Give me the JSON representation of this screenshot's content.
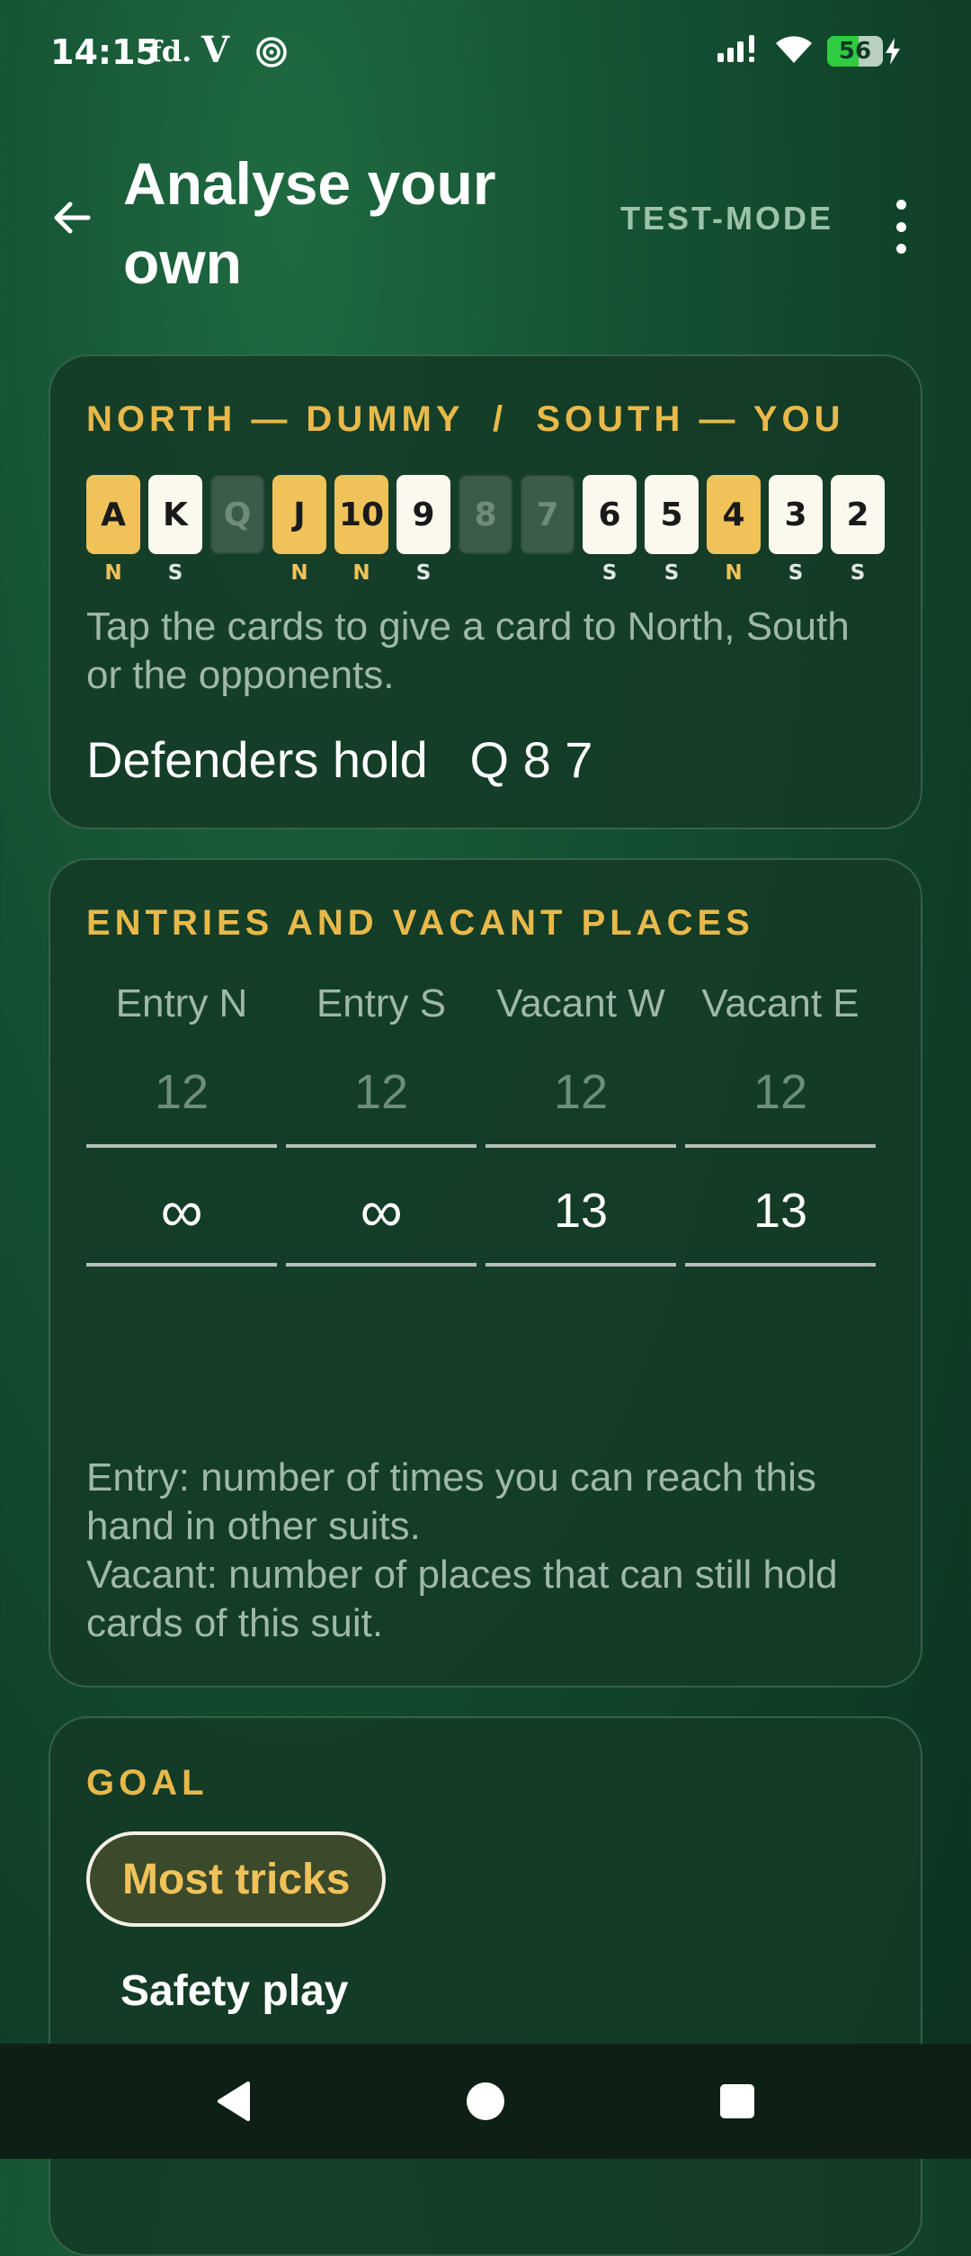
{
  "status_bar": {
    "time": "14:15",
    "app_icons": [
      "fd.",
      "V"
    ],
    "battery": "56",
    "battery_level": 0.56
  },
  "header": {
    "title": "Analyse your own",
    "mode_label": "TEST-MODE"
  },
  "deal": {
    "heading": "NORTH — DUMMY  /  SOUTH — YOU",
    "cards": [
      {
        "rank": "A",
        "owner": "N",
        "state": "north"
      },
      {
        "rank": "K",
        "owner": "S",
        "state": "south"
      },
      {
        "rank": "Q",
        "owner": "",
        "state": "defender"
      },
      {
        "rank": "J",
        "owner": "N",
        "state": "north"
      },
      {
        "rank": "10",
        "owner": "N",
        "state": "north"
      },
      {
        "rank": "9",
        "owner": "S",
        "state": "south"
      },
      {
        "rank": "8",
        "owner": "",
        "state": "defender"
      },
      {
        "rank": "7",
        "owner": "",
        "state": "defender"
      },
      {
        "rank": "6",
        "owner": "S",
        "state": "south"
      },
      {
        "rank": "5",
        "owner": "S",
        "state": "south"
      },
      {
        "rank": "4",
        "owner": "N",
        "state": "north"
      },
      {
        "rank": "3",
        "owner": "S",
        "state": "south"
      },
      {
        "rank": "2",
        "owner": "S",
        "state": "south"
      }
    ],
    "hint": "Tap the cards to give a card to North, South or the opponents.",
    "defenders": "Defenders hold   Q 8 7"
  },
  "entries": {
    "heading": "ENTRIES AND VACANT PLACES",
    "columns": [
      {
        "label": "Entry N",
        "placeholder": "12",
        "value": "∞"
      },
      {
        "label": "Entry S",
        "placeholder": "12",
        "value": "∞"
      },
      {
        "label": "Vacant W",
        "placeholder": "12",
        "value": "13"
      },
      {
        "label": "Vacant E",
        "placeholder": "12",
        "value": "13"
      }
    ],
    "explain_entry": "Entry: number of times you can reach this hand in other suits.",
    "explain_vacant": "Vacant: number of places that can still hold cards of this suit."
  },
  "goal": {
    "heading": "GOAL",
    "options": [
      "Most tricks",
      "Safety play"
    ]
  },
  "colors": {
    "accent": "#e8b94a",
    "background": "#155233",
    "card_bg": "#143a25",
    "north_card": "#efc25a",
    "south_card": "#fbf8ee",
    "defender_card": "#3b5c48"
  }
}
